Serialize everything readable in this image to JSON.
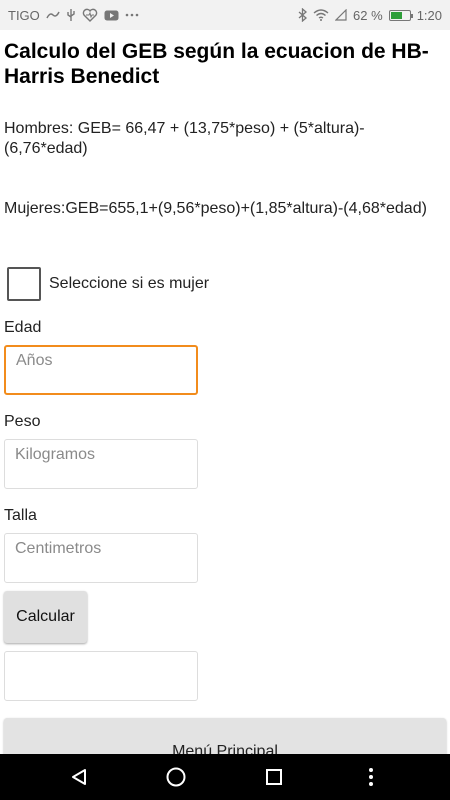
{
  "status_bar": {
    "carrier": "TIGO",
    "battery_text": "62 %",
    "battery_level": 0.62,
    "time": "1:20",
    "icons": [
      "signal-icon",
      "usb-icon",
      "health-icon",
      "youtube-icon",
      "more-icon",
      "bluetooth-icon",
      "wifi-icon",
      "cell-signal-icon",
      "battery-icon"
    ]
  },
  "page": {
    "title": "Calculo del GEB según la ecuacion de HB-Harris Benedict",
    "formula_men": "Hombres: GEB= 66,47 + (13,75*peso) + (5*altura)-(6,76*edad)",
    "formula_women": "Mujeres:GEB=655,1+(9,56*peso)+(1,85*altura)-(4,68*edad)"
  },
  "form": {
    "checkbox_label": "Seleccione si es mujer",
    "age_label": "Edad",
    "age_placeholder": "Años",
    "weight_label": "Peso",
    "weight_placeholder": "Kilogramos",
    "height_label": "Talla",
    "height_placeholder": "Centimetros",
    "calculate_label": "Calcular",
    "result_value": "",
    "menu_label": "Menú Principal"
  },
  "nav_bar": {
    "icons": [
      "back-icon",
      "home-icon",
      "recents-icon",
      "menu-icon"
    ]
  },
  "colors": {
    "focus": "#f28c1c",
    "battery": "#2e9e3a"
  }
}
